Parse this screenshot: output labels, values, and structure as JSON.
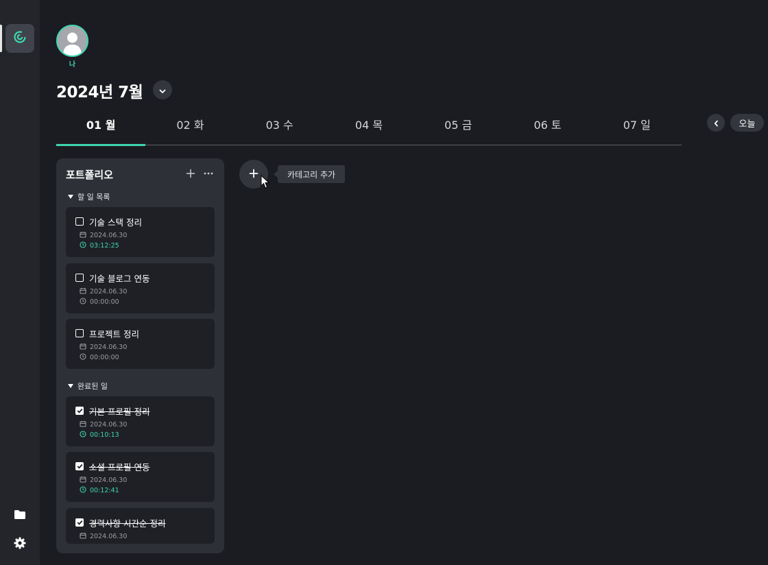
{
  "profile": {
    "name": "나"
  },
  "header": {
    "month_title": "2024년 7월"
  },
  "week": {
    "days": [
      {
        "label": "01 월",
        "active": true
      },
      {
        "label": "02 화"
      },
      {
        "label": "03 수"
      },
      {
        "label": "04 목"
      },
      {
        "label": "05 금"
      },
      {
        "label": "06 토"
      },
      {
        "label": "07 일"
      }
    ],
    "today_label": "오늘"
  },
  "category": {
    "title": "포트폴리오",
    "todo_section": "할 일 목록",
    "done_section": "완료된 일",
    "todo": [
      {
        "title": "기술 스택 정리",
        "date": "2024.06.30",
        "time": "03:12:25"
      },
      {
        "title": "기술 블로그 연동",
        "date": "2024.06.30",
        "time": "00:00:00"
      },
      {
        "title": "프로젝트 정리",
        "date": "2024.06.30",
        "time": "00:00:00"
      }
    ],
    "done": [
      {
        "title": "기본 프로필 정리",
        "date": "2024.06.30",
        "time": "00:10:13"
      },
      {
        "title": "소셜 프로필 연동",
        "date": "2024.06.30",
        "time": "00:12:41"
      },
      {
        "title": "경력사항 시간순 정리",
        "date": "2024.06.30"
      }
    ]
  },
  "add_category_tooltip": "카테고리 추가",
  "colors": {
    "accent": "#3fd6b0",
    "background": "#1b1c21",
    "sidebar": "#23252b",
    "card": "#2d3037",
    "task": "#1f2026"
  }
}
